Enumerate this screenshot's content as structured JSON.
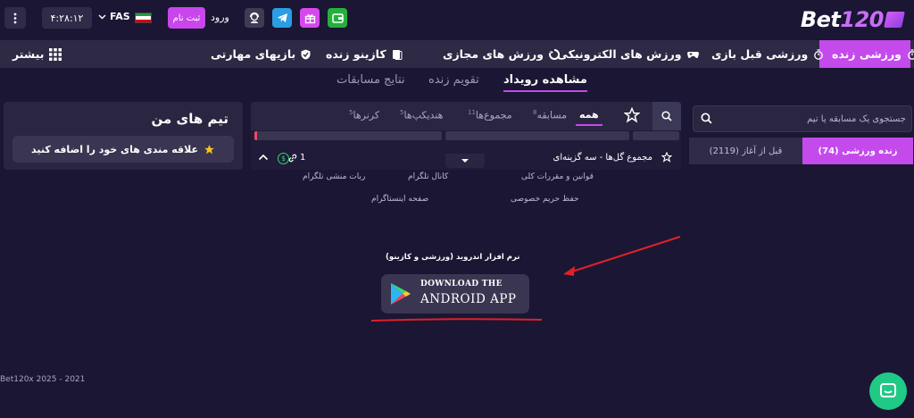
{
  "topbar": {
    "logo_text": "Bet",
    "logo_num": "120",
    "login": "ورود",
    "signup": "ثبت نام",
    "language": "FAS",
    "clock": "۴:۲۸:۱۲",
    "icons": [
      "wallet-icon",
      "gift-icon",
      "telegram-icon",
      "support-icon",
      "kebab-menu-icon"
    ],
    "colors": {
      "wallet": "#25b03d",
      "gift": "#d847ee",
      "telegram": "#2a9de3",
      "accent": "#c44aec"
    }
  },
  "nav": {
    "items": [
      {
        "label": "ورزشی زنده",
        "icon": "stopwatch-icon"
      },
      {
        "label": "ورزشی قبل بازی",
        "icon": "timer-icon"
      },
      {
        "label": "ورزش های الکترونیکی",
        "icon": "gamepad-icon"
      },
      {
        "label": "ورزش های مجازی",
        "icon": "virtual-icon"
      },
      {
        "label": "کازینو زنده",
        "icon": "cards-icon"
      },
      {
        "label": "بازیهای مهارتی",
        "icon": "shield-icon"
      }
    ],
    "more": "بیشتر"
  },
  "subtabs": [
    "مشاهده رویداد",
    "تقویم زنده",
    "نتایج مسابقات"
  ],
  "teams": {
    "title": "تیم های من",
    "add_button": "علاقه مندی های خود را اضافه کنید"
  },
  "center": {
    "tabs": [
      {
        "label": "همه",
        "count": ""
      },
      {
        "label": "مسابقه",
        "count": "8"
      },
      {
        "label": "مجموع‌ها",
        "count": "11"
      },
      {
        "label": "هندیکپ‌ها",
        "count": "5"
      },
      {
        "label": "کرنرها",
        "count": "5"
      }
    ],
    "market_title": "مجموع گل‌ها - سه گزینه‌ای",
    "market_count": "1"
  },
  "right": {
    "search_placeholder": "جستجوی یک مسابقه یا تیم",
    "live_tab": "زنده ورزشی (74)",
    "pre_tab": "قبل از آغاز (2119)"
  },
  "footer": {
    "links": [
      "قوانین و مقررات کلی",
      "حفظ حریم خصوصی",
      "کانال تلگرام",
      "صفحه اینستاگرام",
      "ربات منشی تلگرام"
    ],
    "android_label": "نرم افزار اندروید (ورزشی و کازینو)",
    "app_line1": "DOWNLOAD THE",
    "app_line2": "ANDROID APP",
    "copyright": "Bet120x 2025 - 2021"
  }
}
